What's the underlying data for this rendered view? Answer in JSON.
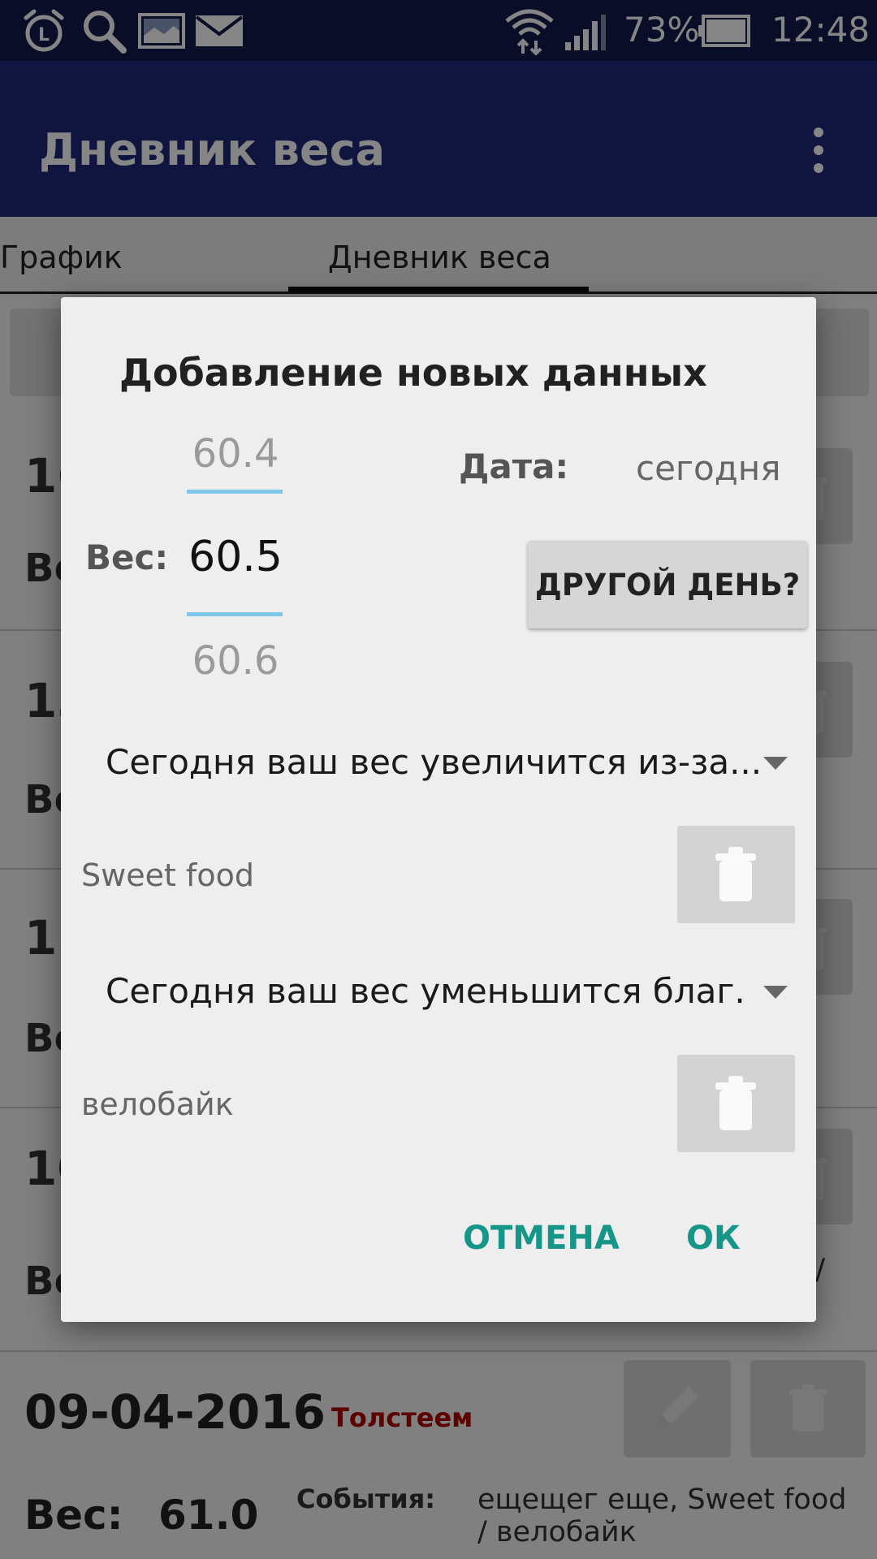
{
  "status_bar": {
    "battery": "73%",
    "time": "12:48",
    "icons": [
      "alarm-icon",
      "search-icon",
      "gallery-icon",
      "mail-icon",
      "wifi-icon",
      "signal-icon",
      "battery-icon"
    ]
  },
  "app_bar": {
    "title": "Дневник веса",
    "overflow_icon": "more-vert-icon"
  },
  "tabs": [
    {
      "label": "График"
    },
    {
      "label": "Дневник веса",
      "selected": true
    }
  ],
  "background_list": {
    "cards": [
      {
        "date_partial": "16",
        "ves_partial": "Ве"
      },
      {
        "date_partial": "13",
        "ves_partial": "Ве"
      },
      {
        "date_partial": "12",
        "ves_partial": "Ве"
      },
      {
        "date_partial": "10",
        "ves_partial": "Ве",
        "trail": "/"
      }
    ],
    "last_card": {
      "date": "09-04-2016",
      "label": "Толстеем",
      "ves_label": "Вес:",
      "ves_value": "61.0",
      "events_label": "События:",
      "events_text": "ещещег еще, Sweet food / велобайк"
    }
  },
  "dialog": {
    "title": "Добавление новых данных",
    "weight_label": "Вес:",
    "picker": {
      "prev": "60.4",
      "current": "60.5",
      "next": "60.6"
    },
    "date_label": "Дата:",
    "date_value": "сегодня",
    "other_day_button": "ДРУГОЙ ДЕНЬ?",
    "gain_spinner": "Сегодня ваш вес увеличится из-за...",
    "gain_item": "Sweet food",
    "loss_spinner": "Сегодня ваш вес уменьшится благ.",
    "loss_item": "велобайк",
    "cancel_button": "ОТМЕНА",
    "ok_button": "ОК"
  },
  "colors": {
    "status_bar": "#131a4c",
    "app_bar": "#1e2a78",
    "accent_teal": "#159688",
    "picker_line": "#7ec6ea",
    "label_red": "#b00000"
  }
}
